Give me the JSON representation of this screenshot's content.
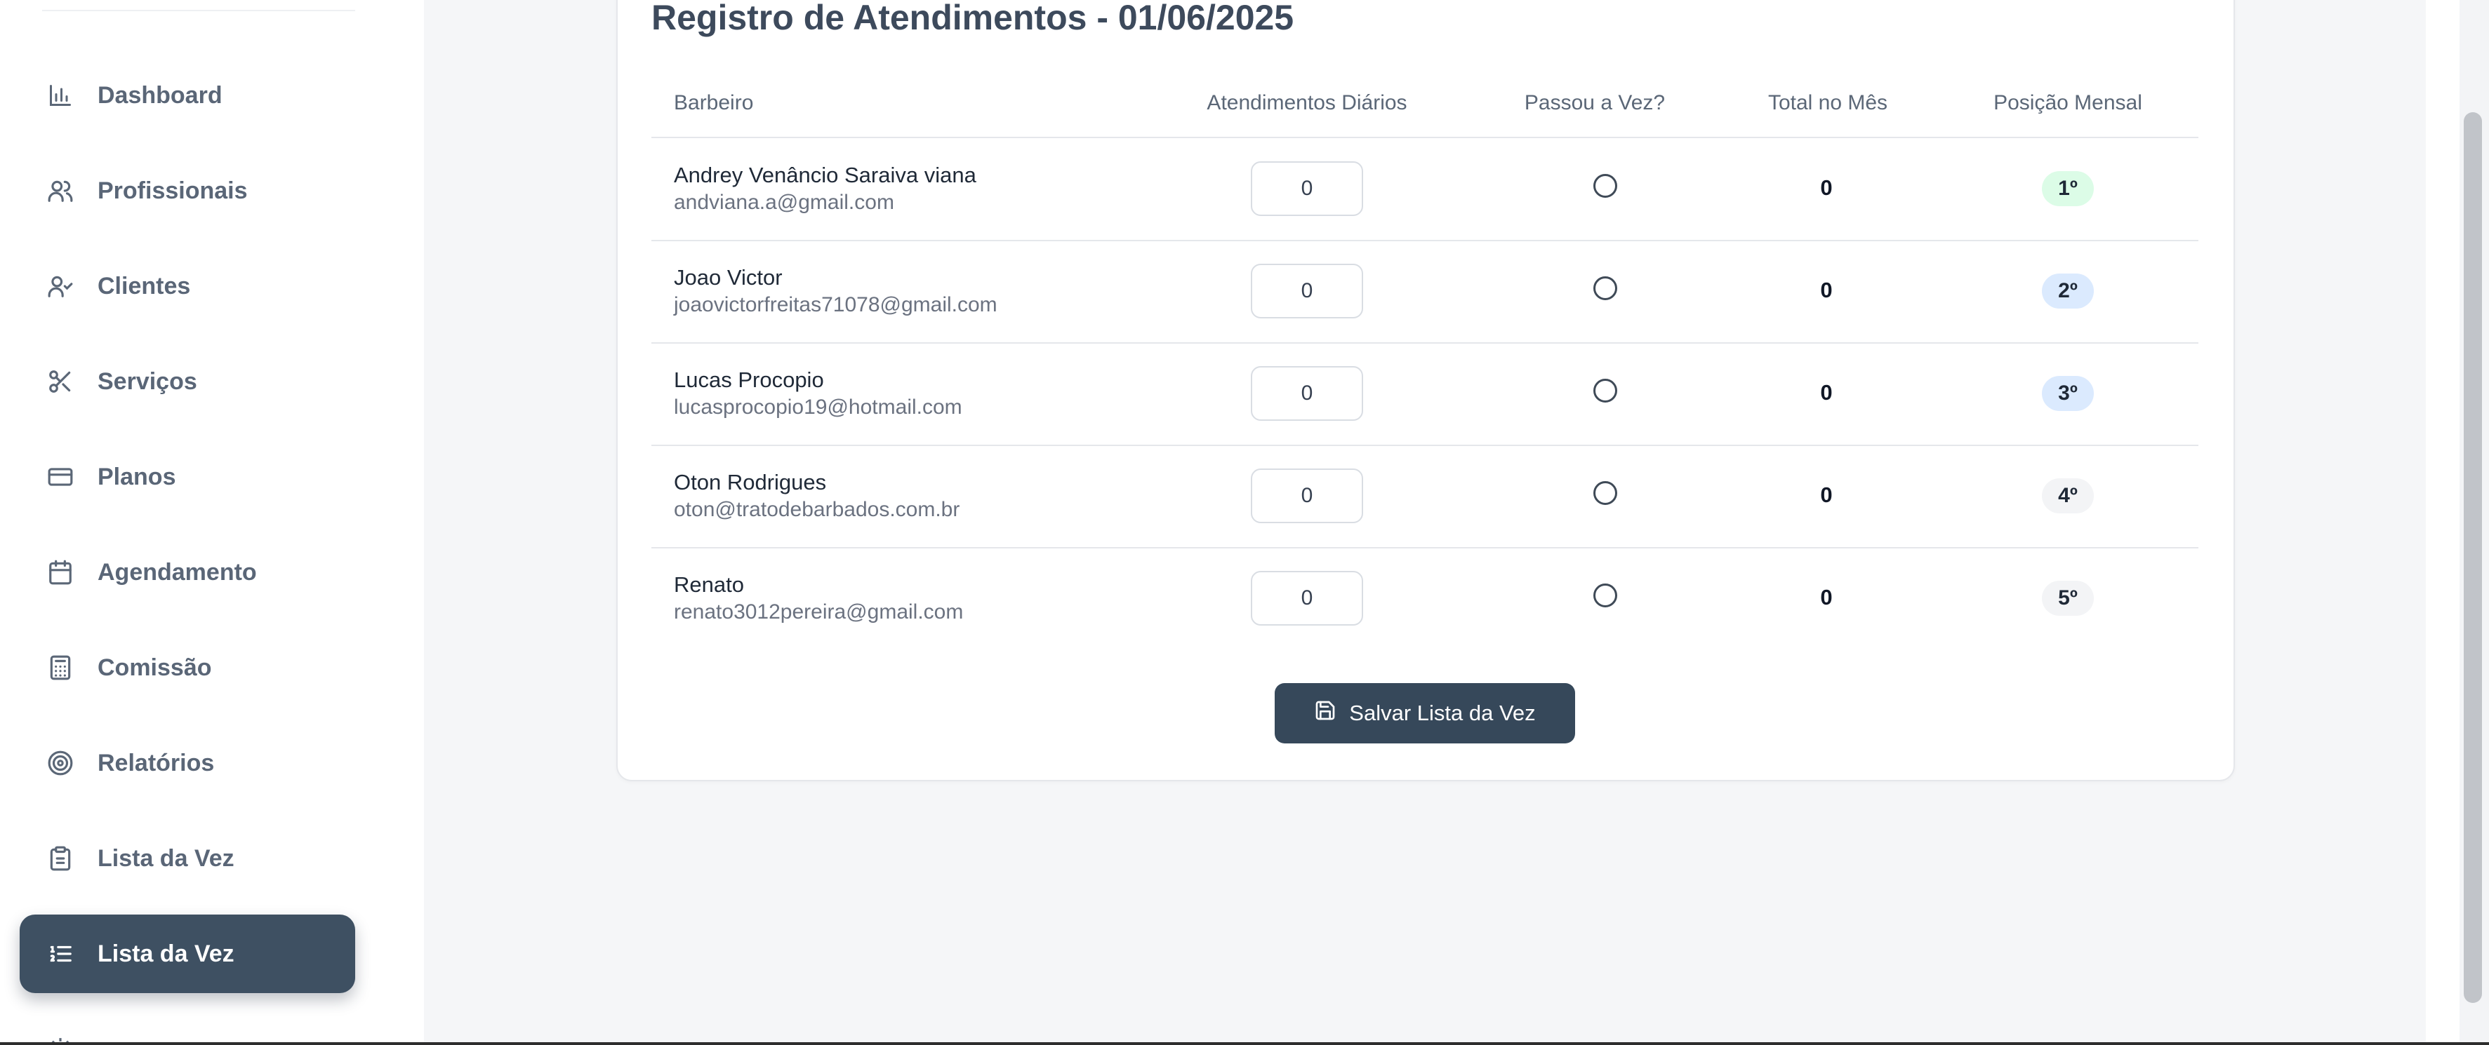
{
  "sidebar": {
    "items": [
      {
        "label": "Dashboard",
        "icon": "bar-chart-icon",
        "active": false
      },
      {
        "label": "Profissionais",
        "icon": "users-icon",
        "active": false
      },
      {
        "label": "Clientes",
        "icon": "user-check-icon",
        "active": false
      },
      {
        "label": "Serviços",
        "icon": "scissors-icon",
        "active": false
      },
      {
        "label": "Planos",
        "icon": "credit-card-icon",
        "active": false
      },
      {
        "label": "Agendamento",
        "icon": "calendar-icon",
        "active": false
      },
      {
        "label": "Comissão",
        "icon": "calculator-icon",
        "active": false
      },
      {
        "label": "Relatórios",
        "icon": "target-icon",
        "active": false
      },
      {
        "label": "Lista da Vez",
        "icon": "clipboard-list-icon",
        "active": false
      },
      {
        "label": "Lista da Vez",
        "icon": "list-ordered-icon",
        "active": true
      }
    ]
  },
  "card": {
    "title": "Registro de Atendimentos - 01/06/2025",
    "columns": {
      "barbeiro": "Barbeiro",
      "daily": "Atendimentos Diários",
      "passou": "Passou a Vez?",
      "total": "Total no Mês",
      "posicao": "Posição Mensal"
    },
    "rows": [
      {
        "name": "Andrey Venâncio Saraiva viana",
        "email": "andviana.a@gmail.com",
        "daily": "0",
        "total": "0",
        "position": "1º"
      },
      {
        "name": "Joao Victor",
        "email": "joaovictorfreitas71078@gmail.com",
        "daily": "0",
        "total": "0",
        "position": "2º"
      },
      {
        "name": "Lucas Procopio",
        "email": "lucasprocopio19@hotmail.com",
        "daily": "0",
        "total": "0",
        "position": "3º"
      },
      {
        "name": "Oton Rodrigues",
        "email": "oton@tratodebarbados.com.br",
        "daily": "0",
        "total": "0",
        "position": "4º"
      },
      {
        "name": "Renato",
        "email": "renato3012pereira@gmail.com",
        "daily": "0",
        "total": "0",
        "position": "5º"
      }
    ],
    "save_label": "Salvar Lista da Vez"
  },
  "colors": {
    "primary": "#36485a",
    "badge_first": "#dcfce7",
    "badge_second_third": "#dbeafe",
    "badge_other": "#f3f4f6"
  }
}
